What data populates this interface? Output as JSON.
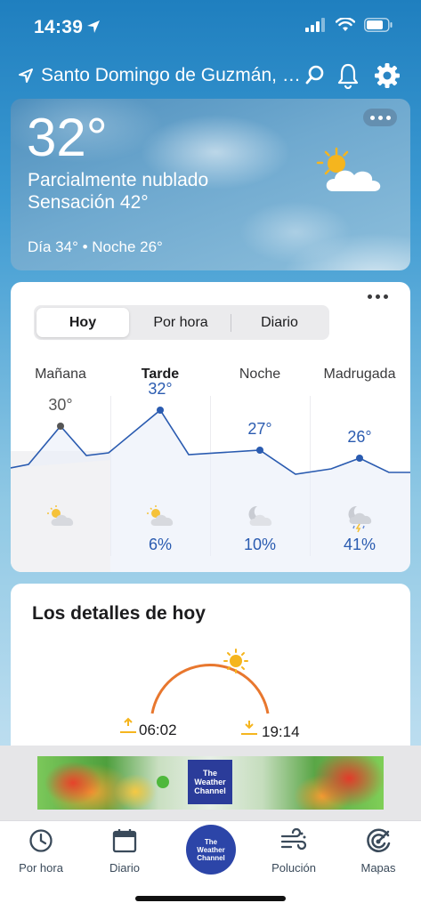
{
  "status_bar": {
    "time": "14:39",
    "icons": [
      "location-arrow-icon",
      "signal-icon",
      "wifi-icon",
      "battery-icon"
    ]
  },
  "location": {
    "name": "Santo Domingo de Guzmán, Di...",
    "icons": [
      "navigation-arrow-icon",
      "search-icon",
      "bell-icon",
      "gear-icon"
    ]
  },
  "current": {
    "temperature": "32°",
    "condition": "Parcialmente nublado",
    "feels_like": "Sensación 42°",
    "day_night": "Día 34° • Noche 26°",
    "icon": "partly-cloudy-icon"
  },
  "forecast": {
    "tabs": [
      {
        "label": "Hoy",
        "active": true
      },
      {
        "label": "Por hora",
        "active": false
      },
      {
        "label": "Diario",
        "active": false
      }
    ],
    "periods": [
      {
        "name": "Mañana",
        "temp": "30°",
        "temp_value": 30,
        "precip": "",
        "icon": "partly-cloudy-icon",
        "active": false,
        "past": true
      },
      {
        "name": "Tarde",
        "temp": "32°",
        "temp_value": 32,
        "precip": "6%",
        "icon": "partly-cloudy-icon",
        "active": true,
        "past": false
      },
      {
        "name": "Noche",
        "temp": "27°",
        "temp_value": 27,
        "precip": "10%",
        "icon": "partly-cloudy-night-icon",
        "active": false,
        "past": false
      },
      {
        "name": "Madrugada",
        "temp": "26°",
        "temp_value": 26,
        "precip": "41%",
        "icon": "thunderstorm-night-icon",
        "active": false,
        "past": false
      }
    ],
    "colors": {
      "line": "#2a5bb0",
      "past_point": "#555555",
      "fill": "#e9eef9"
    }
  },
  "details": {
    "title": "Los detalles de hoy",
    "sunrise": "06:02",
    "sunset": "19:14",
    "colors": {
      "arc": "#e8772e",
      "sun": "#f5b51e"
    }
  },
  "ad": {
    "brand_lines": [
      "The",
      "Weather",
      "Channel"
    ]
  },
  "tab_bar": {
    "items": [
      {
        "label": "Por hora",
        "icon": "clock-icon"
      },
      {
        "label": "Diario",
        "icon": "calendar-icon"
      },
      {
        "label": "",
        "icon": "the-weather-channel-logo"
      },
      {
        "label": "Polución",
        "icon": "wind-icon"
      },
      {
        "label": "Mapas",
        "icon": "radar-icon"
      }
    ],
    "center_logo_lines": [
      "The",
      "Weather",
      "Channel"
    ]
  }
}
